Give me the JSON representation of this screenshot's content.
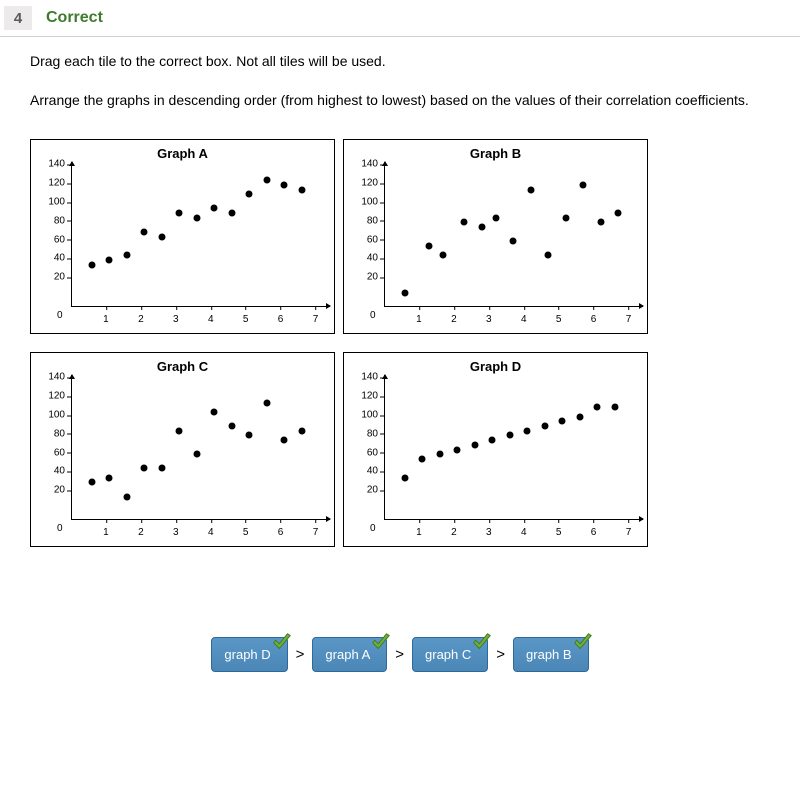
{
  "question_number": "4",
  "status_label": "Correct",
  "instruction_line1": "Drag each tile to the correct box. Not all tiles will be used.",
  "instruction_line2": "Arrange the graphs in descending order (from highest to lowest) based on the values of their correlation coefficients.",
  "axis": {
    "y_ticks": [
      20,
      40,
      60,
      80,
      100,
      120,
      140
    ],
    "x_ticks": [
      1,
      2,
      3,
      4,
      5,
      6,
      7
    ],
    "y_max": 150,
    "x_max": 7.3,
    "origin": "0"
  },
  "chart_data": [
    {
      "type": "scatter",
      "title": "Graph A",
      "series": [
        {
          "name": "A",
          "points": [
            {
              "x": 0.6,
              "y": 45
            },
            {
              "x": 1.1,
              "y": 50
            },
            {
              "x": 1.6,
              "y": 55
            },
            {
              "x": 2.1,
              "y": 80
            },
            {
              "x": 2.6,
              "y": 75
            },
            {
              "x": 3.1,
              "y": 100
            },
            {
              "x": 3.6,
              "y": 95
            },
            {
              "x": 4.1,
              "y": 105
            },
            {
              "x": 4.6,
              "y": 100
            },
            {
              "x": 5.1,
              "y": 120
            },
            {
              "x": 5.6,
              "y": 135
            },
            {
              "x": 6.1,
              "y": 130
            },
            {
              "x": 6.6,
              "y": 125
            }
          ]
        }
      ]
    },
    {
      "type": "scatter",
      "title": "Graph B",
      "series": [
        {
          "name": "B",
          "points": [
            {
              "x": 0.6,
              "y": 15
            },
            {
              "x": 1.3,
              "y": 65
            },
            {
              "x": 1.7,
              "y": 55
            },
            {
              "x": 2.3,
              "y": 90
            },
            {
              "x": 2.8,
              "y": 85
            },
            {
              "x": 3.2,
              "y": 95
            },
            {
              "x": 3.7,
              "y": 70
            },
            {
              "x": 4.2,
              "y": 125
            },
            {
              "x": 4.7,
              "y": 55
            },
            {
              "x": 5.2,
              "y": 95
            },
            {
              "x": 5.7,
              "y": 130
            },
            {
              "x": 6.2,
              "y": 90
            },
            {
              "x": 6.7,
              "y": 100
            }
          ]
        }
      ]
    },
    {
      "type": "scatter",
      "title": "Graph C",
      "series": [
        {
          "name": "C",
          "points": [
            {
              "x": 0.6,
              "y": 40
            },
            {
              "x": 1.1,
              "y": 45
            },
            {
              "x": 1.6,
              "y": 25
            },
            {
              "x": 2.1,
              "y": 55
            },
            {
              "x": 2.6,
              "y": 55
            },
            {
              "x": 3.1,
              "y": 95
            },
            {
              "x": 3.6,
              "y": 70
            },
            {
              "x": 4.1,
              "y": 115
            },
            {
              "x": 4.6,
              "y": 100
            },
            {
              "x": 5.1,
              "y": 90
            },
            {
              "x": 5.6,
              "y": 125
            },
            {
              "x": 6.1,
              "y": 85
            },
            {
              "x": 6.6,
              "y": 95
            }
          ]
        }
      ]
    },
    {
      "type": "scatter",
      "title": "Graph D",
      "series": [
        {
          "name": "D",
          "points": [
            {
              "x": 0.6,
              "y": 45
            },
            {
              "x": 1.1,
              "y": 65
            },
            {
              "x": 1.6,
              "y": 70
            },
            {
              "x": 2.1,
              "y": 75
            },
            {
              "x": 2.6,
              "y": 80
            },
            {
              "x": 3.1,
              "y": 85
            },
            {
              "x": 3.6,
              "y": 90
            },
            {
              "x": 4.1,
              "y": 95
            },
            {
              "x": 4.6,
              "y": 100
            },
            {
              "x": 5.1,
              "y": 105
            },
            {
              "x": 5.6,
              "y": 110
            },
            {
              "x": 6.1,
              "y": 120
            },
            {
              "x": 6.6,
              "y": 120
            }
          ]
        }
      ]
    }
  ],
  "answer": {
    "comparator": ">",
    "tiles": [
      {
        "label": "graph D"
      },
      {
        "label": "graph A"
      },
      {
        "label": "graph C"
      },
      {
        "label": "graph B"
      }
    ]
  }
}
